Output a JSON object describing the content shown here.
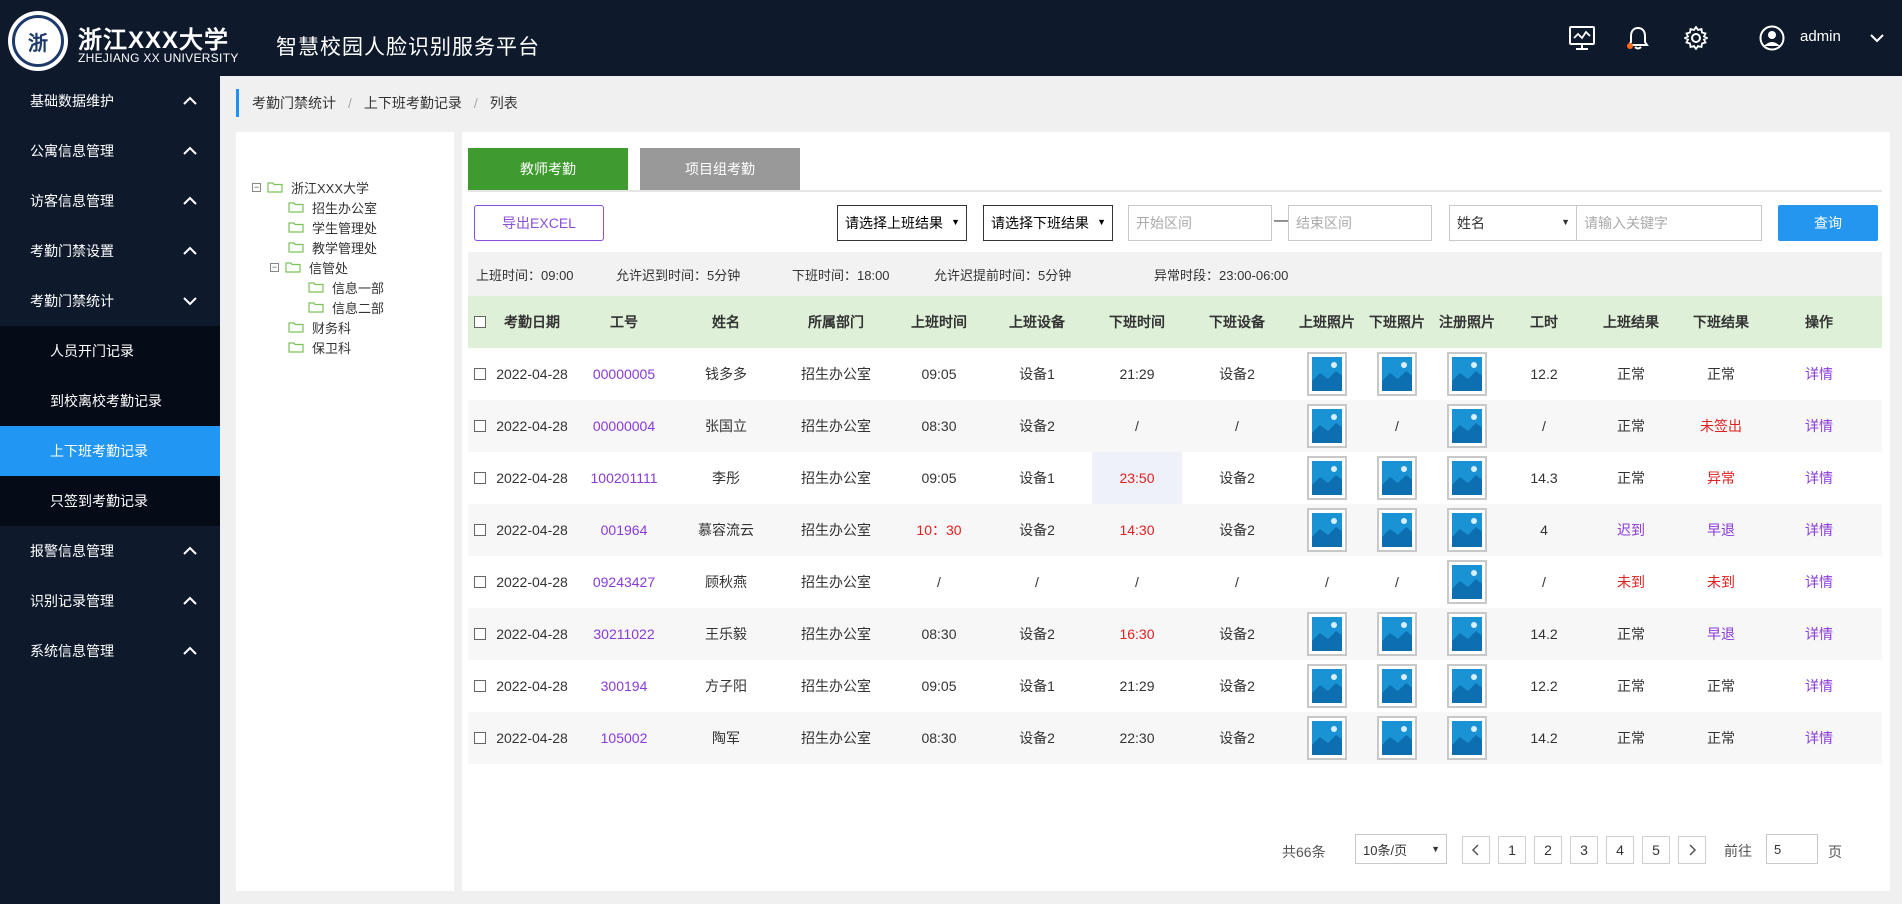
{
  "header": {
    "logo_text": "浙",
    "university_name": "浙江XXX大学",
    "university_en": "ZHEJIANG XX UNIVERSITY",
    "platform_title": "智慧校园人脸识别服务平台",
    "user": "admin"
  },
  "sidebar": {
    "items": [
      {
        "label": "基础数据维护"
      },
      {
        "label": "公寓信息管理"
      },
      {
        "label": "访客信息管理"
      },
      {
        "label": "考勤门禁设置"
      },
      {
        "label": "考勤门禁统计"
      },
      {
        "label": "报警信息管理"
      },
      {
        "label": "识别记录管理"
      },
      {
        "label": "系统信息管理"
      }
    ],
    "sub_items": [
      {
        "label": "人员开门记录"
      },
      {
        "label": "到校离校考勤记录"
      },
      {
        "label": "上下班考勤记录"
      },
      {
        "label": "只签到考勤记录"
      }
    ]
  },
  "breadcrumb": {
    "level1": "考勤门禁统计",
    "level2": "上下班考勤记录",
    "level3": "列表"
  },
  "tree": {
    "root": "浙江XXX大学",
    "n1": "招生办公室",
    "n2": "学生管理处",
    "n3": "教学管理处",
    "n4": "信管处",
    "n4a": "信息一部",
    "n4b": "信息二部",
    "n5": "财务科",
    "n6": "保卫科"
  },
  "tabs": {
    "teacher": "教师考勤",
    "project": "项目组考勤"
  },
  "toolbar": {
    "export": "导出EXCEL",
    "select_on": "请选择上班结果",
    "select_off": "请选择下班结果",
    "start_placeholder": "开始区间",
    "end_placeholder": "结束区间",
    "field_select": "姓名",
    "keyword_placeholder": "请输入关键字",
    "query": "查询"
  },
  "info": {
    "on_time": "上班时间：09:00",
    "late_allowed": "允许迟到时间：5分钟",
    "off_time": "下班时间：18:00",
    "early_allowed": "允许迟提前时间：5分钟",
    "abnormal": "异常时段：23:00-06:00"
  },
  "table": {
    "columns": [
      "考勤日期",
      "工号",
      "姓名",
      "所属部门",
      "上班时间",
      "上班设备",
      "下班时间",
      "下班设备",
      "上班照片",
      "下班照片",
      "注册照片",
      "工时",
      "上班结果",
      "下班结果",
      "操作"
    ],
    "rows": [
      {
        "date": "2022-04-28",
        "id": "00000005",
        "name": "钱多多",
        "dept": "招生办公室",
        "on": "09:05",
        "on_dev": "设备1",
        "off": "21:29",
        "off_dev": "设备2",
        "hours": "12.2",
        "on_res": "正常",
        "off_res": "正常",
        "action": "详情"
      },
      {
        "date": "2022-04-28",
        "id": "00000004",
        "name": "张国立",
        "dept": "招生办公室",
        "on": "08:30",
        "on_dev": "设备2",
        "off": "/",
        "off_dev": "/",
        "off_photo": "/",
        "hours": "/",
        "on_res": "正常",
        "off_res": "未签出",
        "action": "详情"
      },
      {
        "date": "2022-04-28",
        "id": "100201111",
        "name": "李彤",
        "dept": "招生办公室",
        "on": "09:05",
        "on_dev": "设备1",
        "off": "23:50",
        "off_dev": "设备2",
        "hours": "14.3",
        "on_res": "正常",
        "off_res": "异常",
        "action": "详情"
      },
      {
        "date": "2022-04-28",
        "id": "001964",
        "name": "慕容流云",
        "dept": "招生办公室",
        "on": "10：30",
        "on_dev": "设备2",
        "off": "14:30",
        "off_dev": "设备2",
        "hours": "4",
        "on_res": "迟到",
        "off_res": "早退",
        "action": "详情"
      },
      {
        "date": "2022-04-28",
        "id": "09243427",
        "name": "顾秋燕",
        "dept": "招生办公室",
        "on": "/",
        "on_dev": "/",
        "off": "/",
        "off_dev": "/",
        "on_photo": "/",
        "off_photo": "/",
        "hours": "/",
        "on_res": "未到",
        "off_res": "未到",
        "action": "详情"
      },
      {
        "date": "2022-04-28",
        "id": "30211022",
        "name": "王乐毅",
        "dept": "招生办公室",
        "on": "08:30",
        "on_dev": "设备2",
        "off": "16:30",
        "off_dev": "设备2",
        "hours": "14.2",
        "on_res": "正常",
        "off_res": "早退",
        "action": "详情"
      },
      {
        "date": "2022-04-28",
        "id": "300194",
        "name": "方子阳",
        "dept": "招生办公室",
        "on": "09:05",
        "on_dev": "设备1",
        "off": "21:29",
        "off_dev": "设备2",
        "hours": "12.2",
        "on_res": "正常",
        "off_res": "正常",
        "action": "详情"
      },
      {
        "date": "2022-04-28",
        "id": "105002",
        "name": "陶军",
        "dept": "招生办公室",
        "on": "08:30",
        "on_dev": "设备2",
        "off": "22:30",
        "off_dev": "设备2",
        "hours": "14.2",
        "on_res": "正常",
        "off_res": "正常",
        "action": "详情"
      }
    ]
  },
  "pagination": {
    "total": "共66条",
    "page_size": "10条/页",
    "pages": [
      "1",
      "2",
      "3",
      "4",
      "5"
    ],
    "goto_label": "前往",
    "goto_value": "5",
    "page_unit": "页"
  },
  "colors": {
    "header_bg": "#0e1a2c",
    "active_menu": "#2196f3",
    "tab_green": "#3f9a2f",
    "tab_gray": "#999999",
    "purple": "#8a3ad8",
    "red": "#e02020",
    "query_blue": "#2496f0",
    "header_row": "#dff0d8"
  }
}
